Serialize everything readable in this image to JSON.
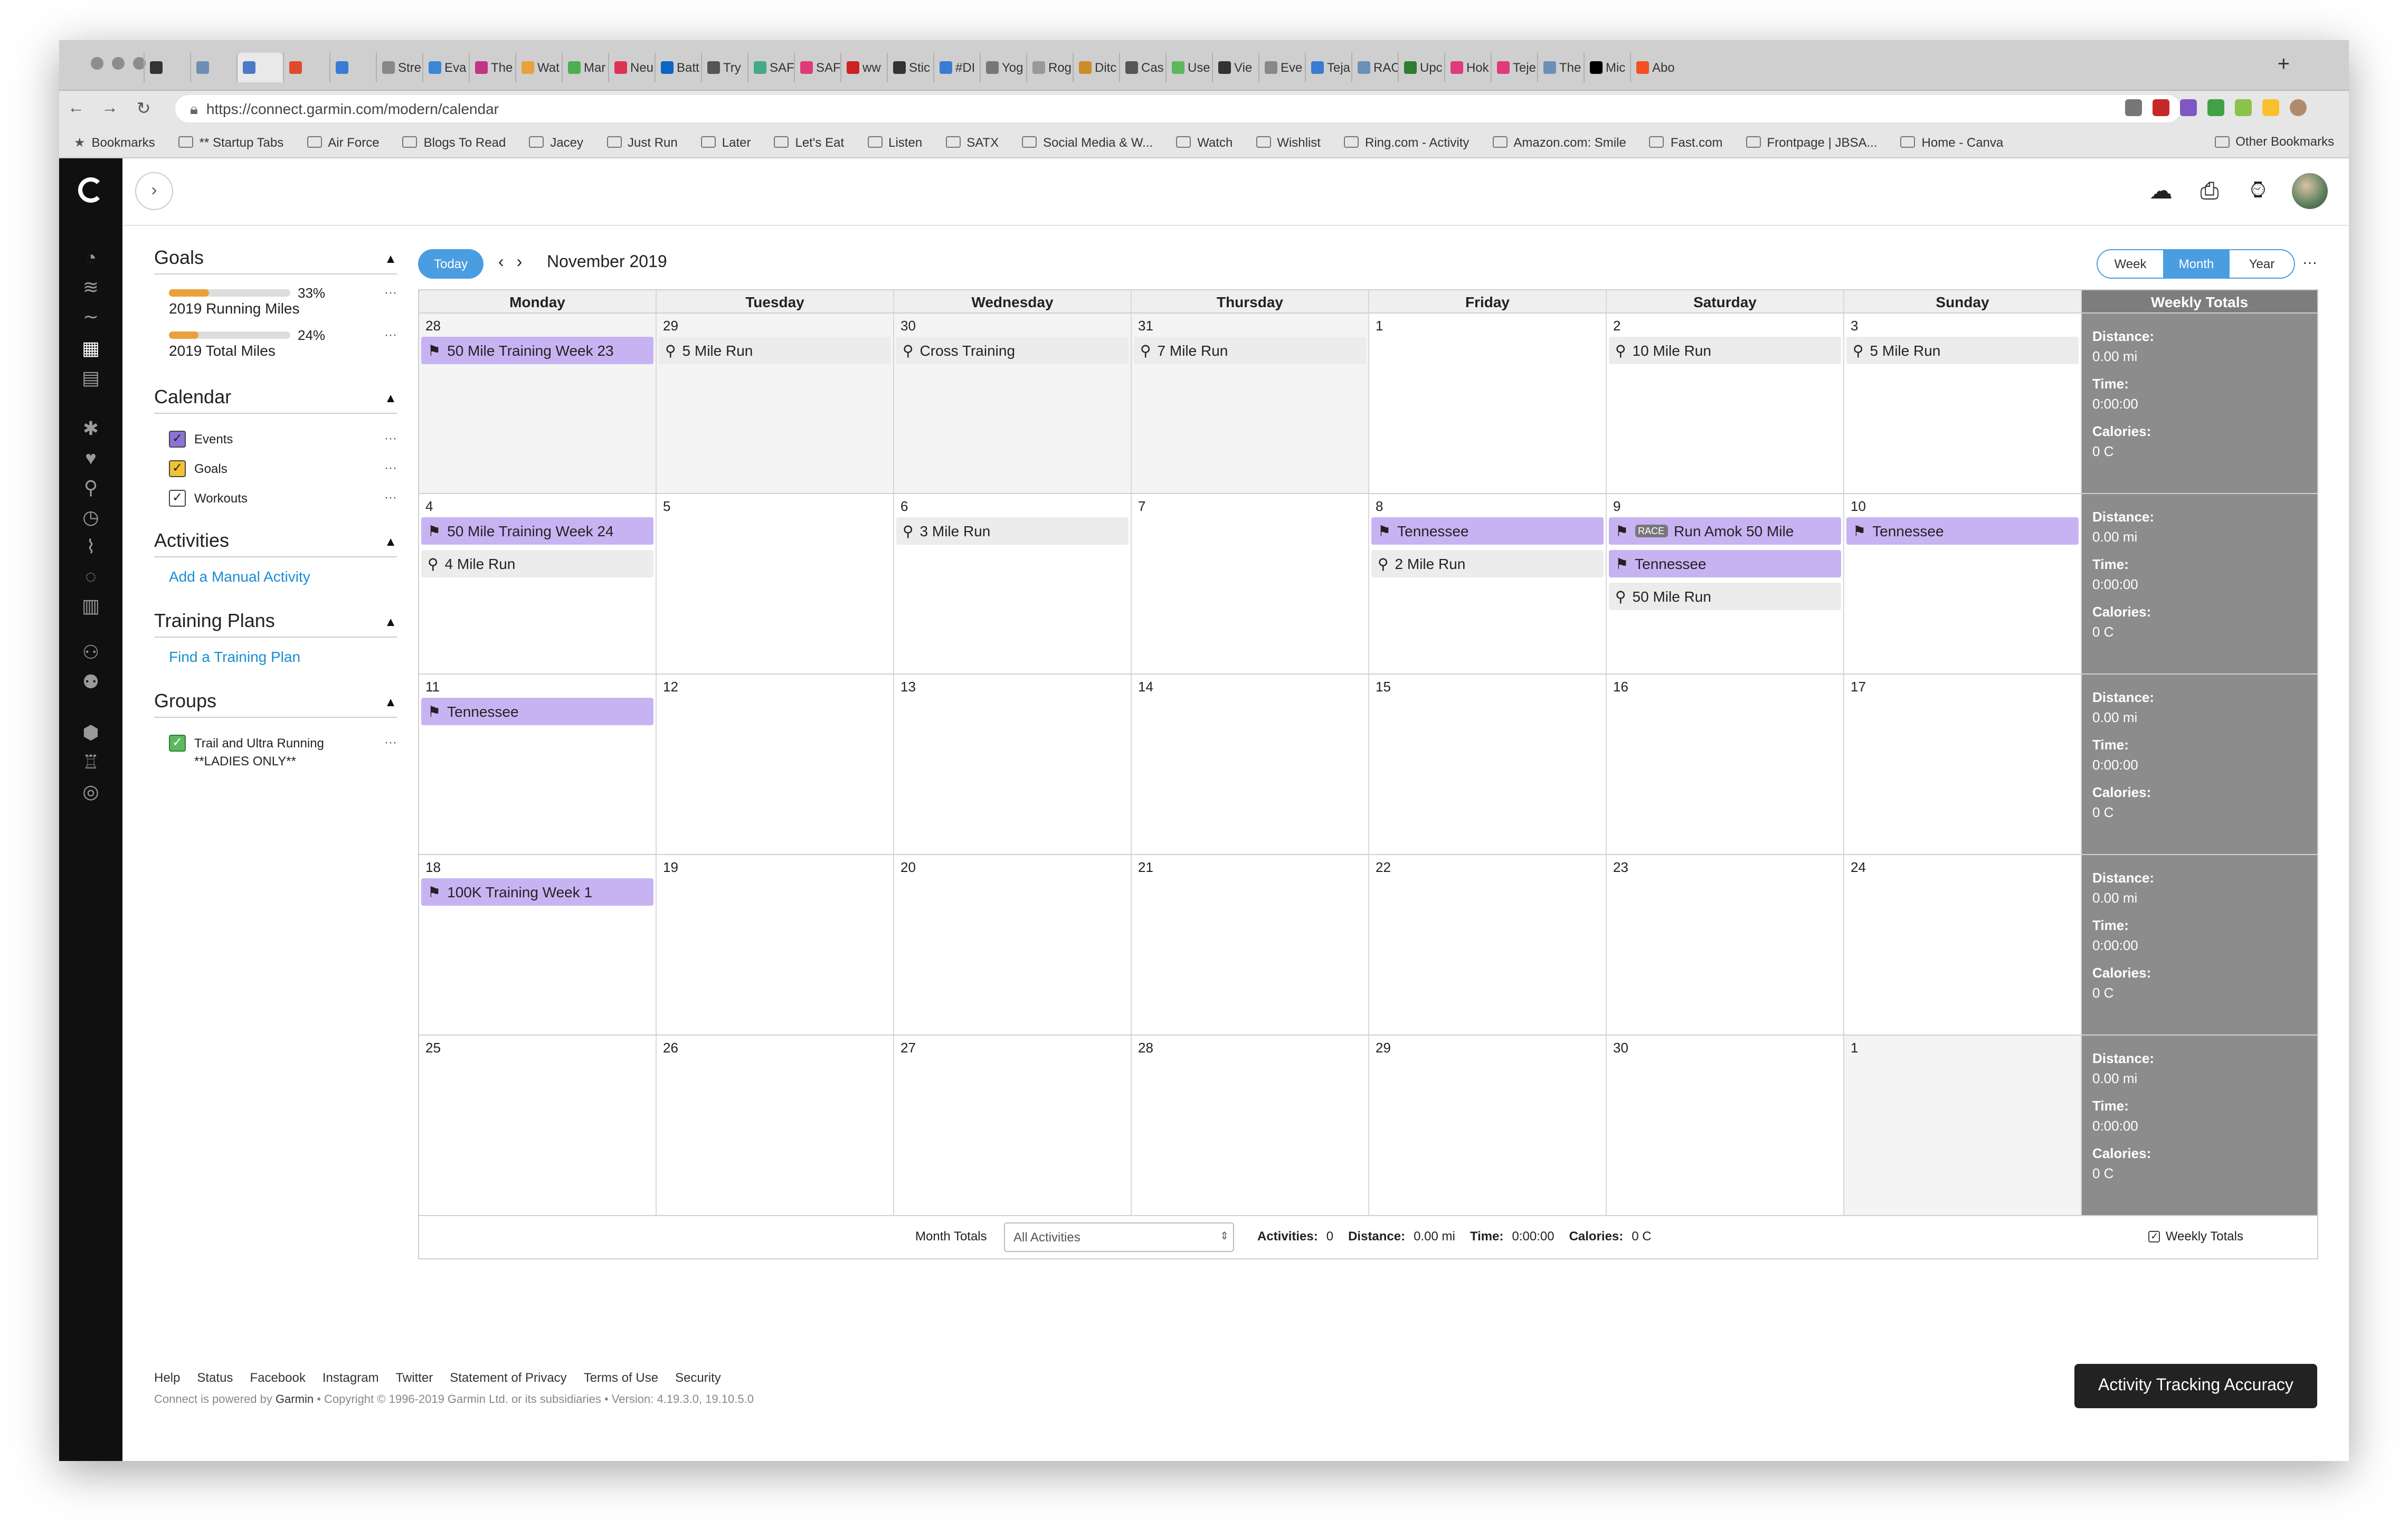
{
  "browser": {
    "tabs": [
      "",
      "",
      "",
      "",
      "",
      "Stre",
      "Eva",
      "The",
      "Wat",
      "Mar",
      "Neu",
      "Batt",
      "Try",
      "SAF",
      "SAF",
      "ww",
      "Stic",
      "#DI",
      "Yog",
      "Rog",
      "Ditc",
      "Cas",
      "Use",
      "Vie",
      "Eve",
      "Teja",
      "RAC",
      "Upc",
      "Hok",
      "Teje",
      "The",
      "Mic",
      "Abo"
    ],
    "tab_colors": [
      "#333",
      "#6c8fb5",
      "#4a7ac8",
      "#e04a2a",
      "#3a7bd5",
      "#888",
      "#3a88d5",
      "#c13584",
      "#e6a23c",
      "#4caf50",
      "#d35",
      "#0a66c2",
      "#555",
      "#4a8",
      "#e03a7c",
      "#c22",
      "#333",
      "#3a7bd5",
      "#777",
      "#999",
      "#cc8c2a",
      "#555",
      "#5cb85c",
      "#333",
      "#888",
      "#3a7bd5",
      "#6c8fb5",
      "#2e7d32",
      "#e03a7c",
      "#e03a7c",
      "#6c8fb5",
      "#000",
      "#f25022",
      "#e8a050"
    ],
    "url": "https://connect.garmin.com/modern/calendar",
    "bookmarks": [
      "Bookmarks",
      "** Startup Tabs",
      "Air Force",
      "Blogs To Read",
      "Jacey",
      "Just Run",
      "Later",
      "Let's Eat",
      "Listen",
      "SATX",
      "Social Media & W...",
      "Watch",
      "Wishlist",
      "Ring.com - Activity",
      "Amazon.com: Smile",
      "Fast.com",
      "Frontpage | JBSA...",
      "Home - Canva"
    ],
    "other_bookmarks": "Other Bookmarks"
  },
  "sidebar": {
    "goals_title": "Goals",
    "goals": [
      {
        "pct_label": "33%",
        "pct": 0.33,
        "name": "2019 Running Miles"
      },
      {
        "pct_label": "24%",
        "pct": 0.24,
        "name": "2019 Total Miles"
      }
    ],
    "calendar_title": "Calendar",
    "calendar_items": [
      {
        "label": "Events",
        "color": "#8a74d6"
      },
      {
        "label": "Goals",
        "color": "#f1c232"
      },
      {
        "label": "Workouts",
        "color": "#ffffff"
      }
    ],
    "activities_title": "Activities",
    "add_activity": "Add a Manual Activity",
    "training_title": "Training Plans",
    "find_plan": "Find a Training Plan",
    "groups_title": "Groups",
    "group_name": "Trail and Ultra Running",
    "group_sub": "**LADIES ONLY**"
  },
  "calendar": {
    "today": "Today",
    "month": "November 2019",
    "views": [
      "Week",
      "Month",
      "Year"
    ],
    "active_view": "Month",
    "weekdays": [
      "Monday",
      "Tuesday",
      "Wednesday",
      "Thursday",
      "Friday",
      "Saturday",
      "Sunday"
    ],
    "weekly_totals_label": "Weekly Totals",
    "weeks": [
      {
        "days": [
          {
            "n": "28",
            "dim": true,
            "events": [
              {
                "t": "plan",
                "label": "50 Mile Training Week 23"
              }
            ]
          },
          {
            "n": "29",
            "dim": true,
            "events": [
              {
                "t": "work",
                "label": "5 Mile Run"
              }
            ]
          },
          {
            "n": "30",
            "dim": true,
            "events": [
              {
                "t": "work",
                "label": "Cross Training"
              }
            ]
          },
          {
            "n": "31",
            "dim": true,
            "events": [
              {
                "t": "work",
                "label": "7 Mile Run"
              }
            ]
          },
          {
            "n": "1",
            "dim": false,
            "events": []
          },
          {
            "n": "2",
            "dim": false,
            "events": [
              {
                "t": "work",
                "label": "10 Mile Run"
              }
            ]
          },
          {
            "n": "3",
            "dim": false,
            "events": [
              {
                "t": "work",
                "label": "5 Mile Run"
              }
            ]
          }
        ],
        "distance": "0.00 mi",
        "time": "0:00:00",
        "calories": "0 C"
      },
      {
        "days": [
          {
            "n": "4",
            "dim": false,
            "events": [
              {
                "t": "plan",
                "label": "50 Mile Training Week 24"
              },
              {
                "t": "work",
                "label": "4 Mile Run"
              }
            ]
          },
          {
            "n": "5",
            "dim": false,
            "events": []
          },
          {
            "n": "6",
            "dim": false,
            "events": [
              {
                "t": "work",
                "label": "3 Mile Run"
              }
            ]
          },
          {
            "n": "7",
            "dim": false,
            "events": []
          },
          {
            "n": "8",
            "dim": false,
            "events": [
              {
                "t": "plan",
                "label": "Tennessee"
              },
              {
                "t": "work",
                "label": "2 Mile Run"
              }
            ]
          },
          {
            "n": "9",
            "dim": false,
            "events": [
              {
                "t": "plan",
                "label": "Run Amok 50 Mile",
                "race": "RACE"
              },
              {
                "t": "plan",
                "label": "Tennessee"
              },
              {
                "t": "work",
                "label": "50 Mile Run"
              }
            ]
          },
          {
            "n": "10",
            "dim": false,
            "events": [
              {
                "t": "plan",
                "label": "Tennessee"
              }
            ]
          }
        ],
        "distance": "0.00 mi",
        "time": "0:00:00",
        "calories": "0 C"
      },
      {
        "days": [
          {
            "n": "11",
            "dim": false,
            "events": [
              {
                "t": "plan",
                "label": "Tennessee"
              }
            ]
          },
          {
            "n": "12",
            "dim": false,
            "events": []
          },
          {
            "n": "13",
            "dim": false,
            "events": []
          },
          {
            "n": "14",
            "dim": false,
            "events": []
          },
          {
            "n": "15",
            "dim": false,
            "events": []
          },
          {
            "n": "16",
            "dim": false,
            "events": []
          },
          {
            "n": "17",
            "dim": false,
            "events": []
          }
        ],
        "distance": "0.00 mi",
        "time": "0:00:00",
        "calories": "0 C"
      },
      {
        "days": [
          {
            "n": "18",
            "dim": false,
            "events": [
              {
                "t": "plan",
                "label": "100K Training Week 1"
              }
            ]
          },
          {
            "n": "19",
            "dim": false,
            "events": []
          },
          {
            "n": "20",
            "dim": false,
            "events": []
          },
          {
            "n": "21",
            "dim": false,
            "events": []
          },
          {
            "n": "22",
            "dim": false,
            "events": []
          },
          {
            "n": "23",
            "dim": false,
            "events": []
          },
          {
            "n": "24",
            "dim": false,
            "events": []
          }
        ],
        "distance": "0.00 mi",
        "time": "0:00:00",
        "calories": "0 C"
      },
      {
        "days": [
          {
            "n": "25",
            "dim": false,
            "events": []
          },
          {
            "n": "26",
            "dim": false,
            "events": []
          },
          {
            "n": "27",
            "dim": false,
            "events": []
          },
          {
            "n": "28",
            "dim": false,
            "events": []
          },
          {
            "n": "29",
            "dim": false,
            "events": []
          },
          {
            "n": "30",
            "dim": false,
            "events": []
          },
          {
            "n": "1",
            "dim": true,
            "events": []
          }
        ],
        "distance": "0.00 mi",
        "time": "0:00:00",
        "calories": "0 C"
      }
    ],
    "totals_labels": {
      "distance": "Distance:",
      "time": "Time:",
      "calories": "Calories:"
    },
    "month_totals": {
      "label": "Month Totals",
      "filter": "All Activities",
      "activities_label": "Activities:",
      "activities": "0",
      "distance_label": "Distance:",
      "distance": "0.00 mi",
      "time_label": "Time:",
      "time": "0:00:00",
      "calories_label": "Calories:",
      "calories": "0 C",
      "weekly_totals_toggle": "Weekly Totals"
    }
  },
  "footer": {
    "links": [
      "Help",
      "Status",
      "Facebook",
      "Instagram",
      "Twitter",
      "Statement of Privacy",
      "Terms of Use",
      "Security"
    ],
    "copyright_prefix": "Connect is powered by",
    "brand": "Garmin",
    "copyright_suffix": "• Copyright © 1996-2019 Garmin Ltd. or its subsidiaries • Version: 4.19.3.0, 19.10.5.0",
    "accuracy_button": "Activity Tracking Accuracy"
  }
}
